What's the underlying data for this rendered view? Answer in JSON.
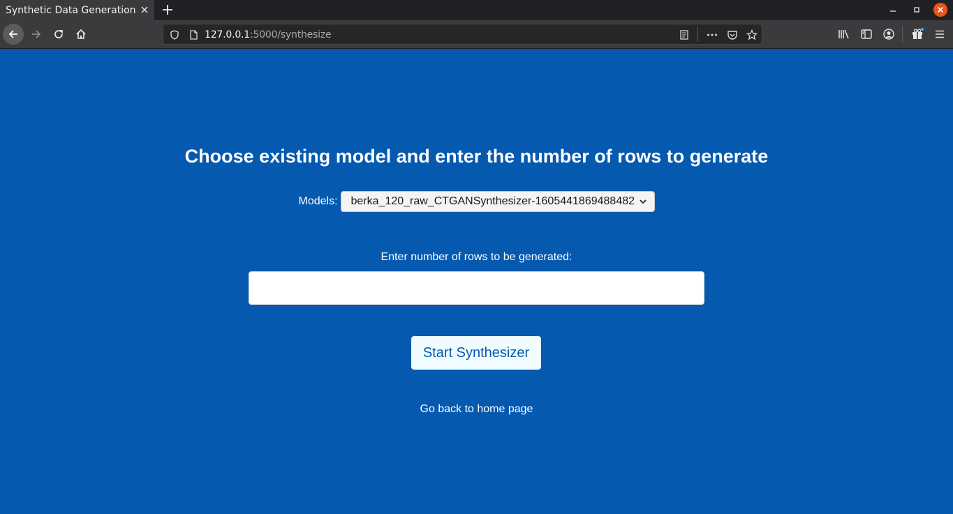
{
  "browser": {
    "tab_title": "Synthetic Data Generation",
    "url_host": "127.0.0.1",
    "url_path": ":5000/synthesize"
  },
  "page": {
    "heading": "Choose existing model and enter the number of rows to generate",
    "models_label": "Models:",
    "selected_model": "berka_120_raw_CTGANSynthesizer-1605441869488482",
    "rows_label": "Enter number of rows to be generated:",
    "rows_value": "",
    "start_button": "Start Synthesizer",
    "home_link": "Go back to home page"
  },
  "colors": {
    "page_background": "#0559af",
    "button_background": "#f0fcff",
    "button_text": "#0559af"
  }
}
